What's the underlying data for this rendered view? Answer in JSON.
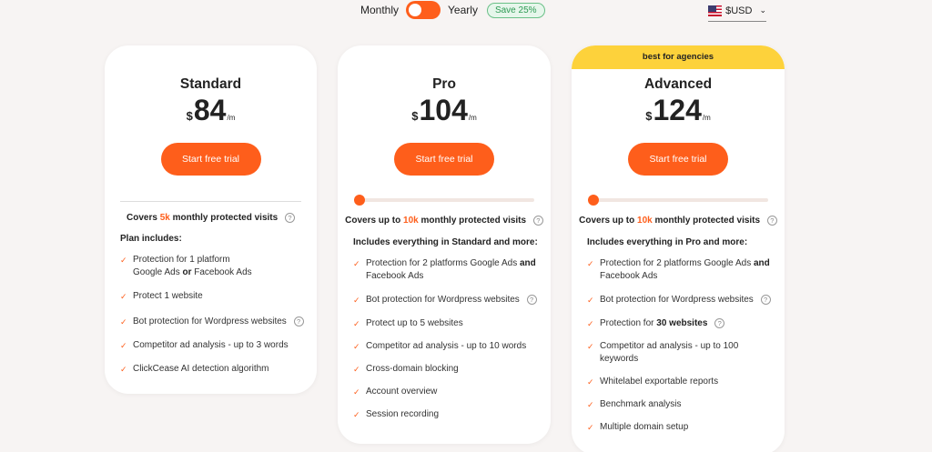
{
  "billing": {
    "monthly_label": "Monthly",
    "yearly_label": "Yearly",
    "save_label": "Save 25%",
    "selected": "yearly"
  },
  "currency": {
    "selected": "$USD",
    "flag_icon": "us-flag-icon"
  },
  "colors": {
    "accent": "#fe5e1b",
    "ribbon": "#fdd23b",
    "save_badge": "#2d9a53"
  },
  "plans": {
    "standard": {
      "name": "Standard",
      "currency": "$",
      "price": "84",
      "per": "/m",
      "cta": "Start free trial",
      "covers_prefix": "Covers",
      "covers_highlight": "5k",
      "covers_suffix": "monthly protected visits",
      "includes": "Plan includes:",
      "features": [
        {
          "before": "Protection for 1 platform",
          "line2a": "Google Ads ",
          "bold": "or",
          "line2b": " Facebook Ads"
        },
        {
          "text": "Protect 1 website"
        },
        {
          "text": "Bot protection for Wordpress websites"
        },
        {
          "text": "Competitor ad analysis - up to 3 words"
        },
        {
          "text": "ClickCease AI detection algorithm"
        }
      ]
    },
    "pro": {
      "name": "Pro",
      "currency": "$",
      "price": "104",
      "per": "/m",
      "cta": "Start free trial",
      "covers_prefix": "Covers up to",
      "covers_highlight": "10k",
      "covers_suffix": "monthly protected visits",
      "includes": "Includes everything in Standard and more:",
      "features": [
        {
          "a": "Protection for 2 platforms Google Ads ",
          "bold": "and",
          "b": " Facebook Ads"
        },
        {
          "text": "Bot protection for Wordpress websites"
        },
        {
          "text": "Protect up to 5 websites"
        },
        {
          "text": "Competitor ad analysis - up to 10 words"
        },
        {
          "text": "Cross-domain blocking"
        },
        {
          "text": "Account overview"
        },
        {
          "text": "Session recording"
        }
      ]
    },
    "advanced": {
      "ribbon": "best for agencies",
      "name": "Advanced",
      "currency": "$",
      "price": "124",
      "per": "/m",
      "cta": "Start free trial",
      "covers_prefix": "Covers up to",
      "covers_highlight": "10k",
      "covers_suffix": "monthly protected visits",
      "includes": "Includes everything in Pro and more:",
      "features": [
        {
          "a": "Protection for 2 platforms Google Ads ",
          "bold": "and",
          "b": " Facebook Ads"
        },
        {
          "text": "Bot protection for Wordpress websites"
        },
        {
          "a": "Protection for ",
          "bold": "30 websites",
          "b": ""
        },
        {
          "text": "Competitor ad analysis - up to 100 keywords"
        },
        {
          "text": "Whitelabel exportable reports"
        },
        {
          "text": "Benchmark analysis"
        },
        {
          "text": "Multiple domain setup"
        }
      ]
    }
  }
}
